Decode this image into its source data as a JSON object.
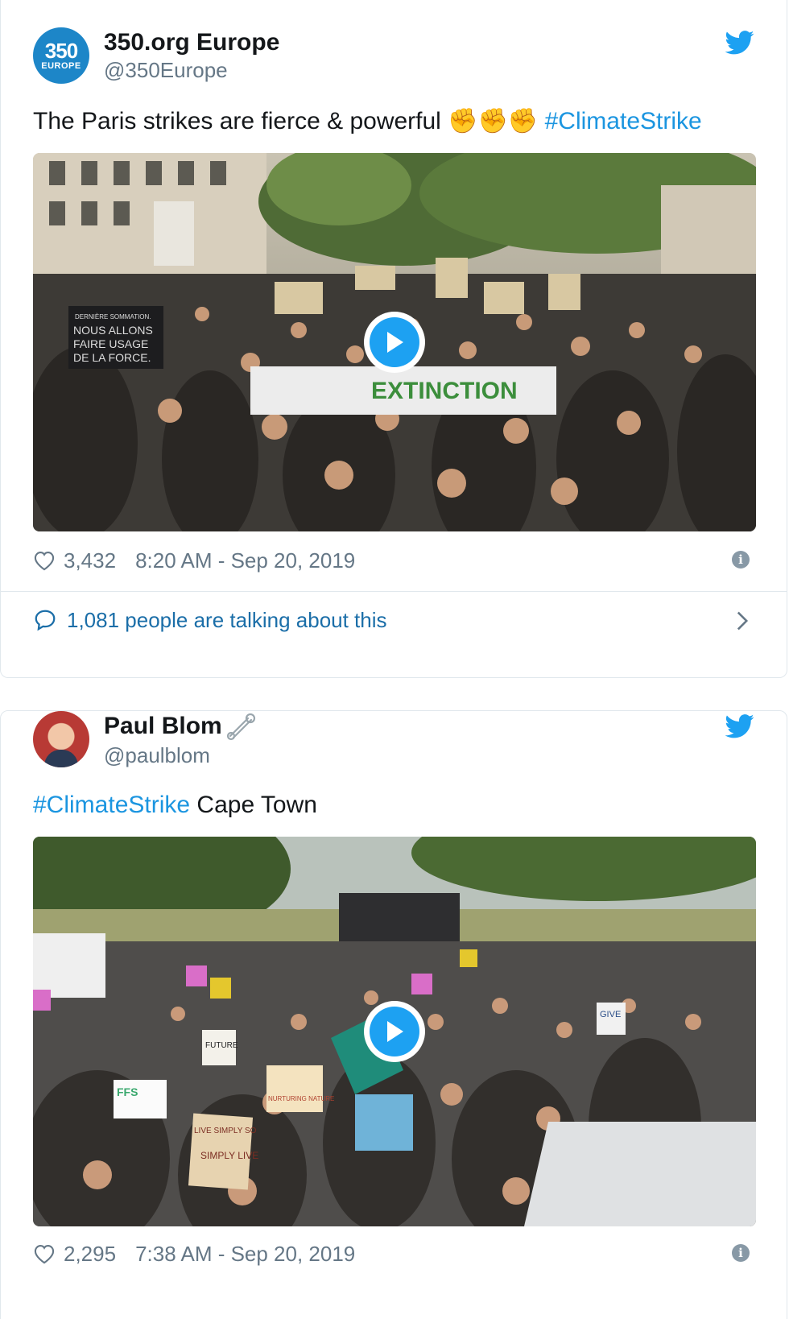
{
  "tweets": [
    {
      "avatar": {
        "logo_num": "350",
        "logo_sub": "EUROPE"
      },
      "display_name": "350.org Europe",
      "handle": "@350Europe",
      "text": "The Paris strikes are fierce & powerful",
      "emoji": [
        "✊",
        "✊",
        "✊"
      ],
      "hashtag": "#ClimateStrike",
      "media_signs": [
        "DERNIÈRE SOMMATION.",
        "NOUS ALLONS",
        "FAIRE USAGE",
        "DE LA FORCE."
      ],
      "likes": "3,432",
      "timestamp": "8:20 AM - Sep 20, 2019",
      "talking": "1,081 people are talking about this"
    },
    {
      "display_name": "Paul Blom",
      "handle": "@paulblom",
      "hashtag": "#ClimateStrike",
      "text_after": "Cape Town",
      "media_signs": [
        "FFS",
        "LIVE SIMPLY SO",
        "SIMPLY LIVE",
        "NURTURING NATURE",
        "FUTURE",
        "GIVE"
      ],
      "likes": "2,295",
      "timestamp": "7:38 AM - Sep 20, 2019"
    }
  ],
  "colors": {
    "link": "#1b95e0",
    "twitter_blue": "#1da1f2",
    "muted": "#657786",
    "border": "#e1e8ed"
  },
  "icons": [
    "twitter-bird-icon",
    "heart-icon",
    "info-icon",
    "speech-bubble-icon",
    "chevron-right-icon",
    "play-icon",
    "safety-pin-icon"
  ]
}
